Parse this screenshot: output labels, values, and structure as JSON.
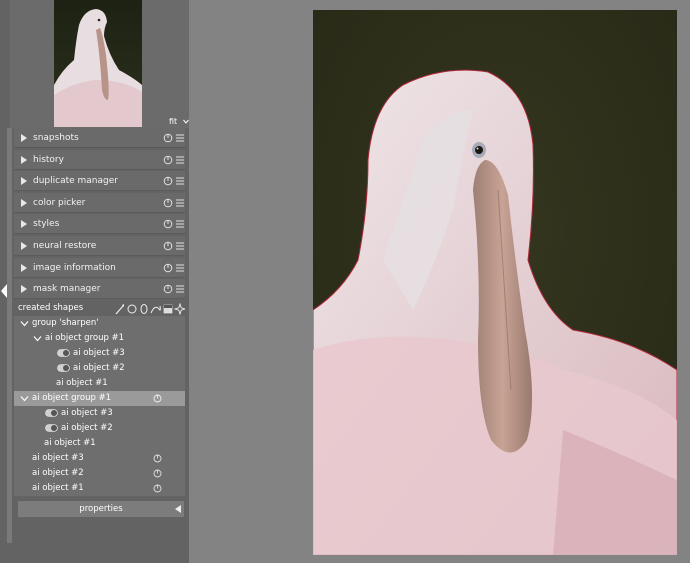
{
  "navigation": {
    "zoom_label": "fit"
  },
  "modules": [
    {
      "label": "snapshots"
    },
    {
      "label": "history"
    },
    {
      "label": "duplicate manager"
    },
    {
      "label": "color picker"
    },
    {
      "label": "styles"
    },
    {
      "label": "neural restore"
    },
    {
      "label": "image information"
    },
    {
      "label": "mask manager"
    }
  ],
  "mask_manager": {
    "created_shapes_label": "created shapes",
    "shape_tools": [
      "brush-icon",
      "circle-icon",
      "ellipse-icon",
      "path-icon",
      "gradient-icon",
      "ai-object-icon"
    ],
    "tree": [
      {
        "label": "group 'sharpen'"
      },
      {
        "label": "ai object group #1"
      },
      {
        "label": "ai object #3"
      },
      {
        "label": "ai object #2"
      },
      {
        "label": "ai object #1"
      },
      {
        "label": "ai object group #1"
      },
      {
        "label": "ai object #3"
      },
      {
        "label": "ai object #2"
      },
      {
        "label": "ai object #1"
      },
      {
        "label": "ai object #3"
      },
      {
        "label": "ai object #2"
      },
      {
        "label": "ai object #1"
      }
    ],
    "properties_label": "properties"
  },
  "colors": {
    "panel_bg": "#636363",
    "center_bg": "#838383",
    "module_bg": "#6a6a6a",
    "selected_row_bg": "#9a9a9a",
    "mask_outline": "#b0283a"
  }
}
